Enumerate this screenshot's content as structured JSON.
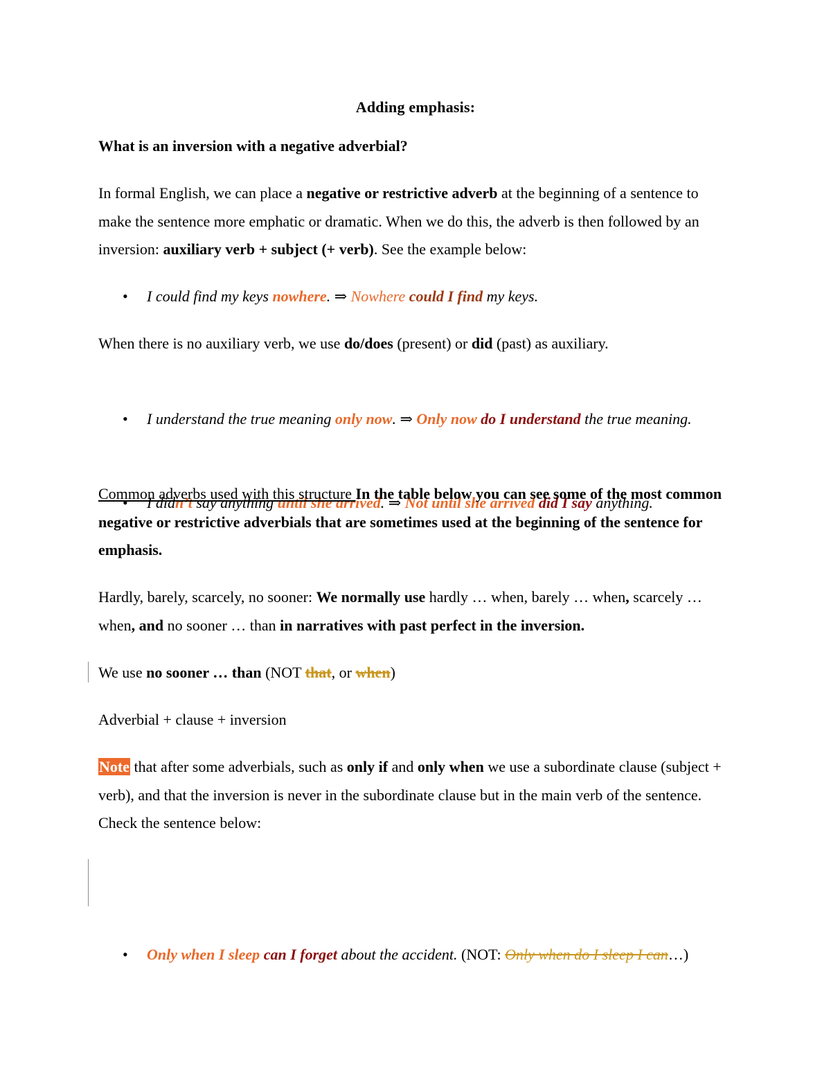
{
  "document": {
    "title": "Adding emphasis:",
    "heading": "What is an inversion with a negative adverbial?",
    "intro": {
      "runs": [
        "In formal English, we can place a ",
        "negative or restrictive adverb",
        " at the beginning of a sentence to make the sentence more emphatic or dramatic. When we do this, the adverb is then followed by an inversion: ",
        "auxiliary verb + subject (+ verb)",
        ". See the example below:"
      ]
    },
    "example1": {
      "bullet": "•",
      "runs": [
        "I could find my keys ",
        "nowhere",
        ". ",
        "⇒ ",
        "Nowhere",
        " ",
        "could I find",
        " my keys."
      ]
    },
    "auxiliary": {
      "runs": [
        "When there is no auxiliary verb, we use ",
        "do/does",
        " (present) or ",
        "did",
        " (past) as auxiliary."
      ]
    },
    "example2": {
      "bullet": "•",
      "runs": [
        "I understand the true meaning ",
        "only now",
        ". ⇒ ",
        "Only now",
        " ",
        "do I understand",
        " the true meaning."
      ]
    },
    "example3": {
      "bullet": "•",
      "runs": [
        "I did",
        "n’t",
        " say anything ",
        "until she arrived",
        ". ⇒ ",
        "Not until she arrived",
        " ",
        "did I say",
        " anything."
      ]
    },
    "common": {
      "runs": [
        "Common adverbs used with this structure ",
        "In the table below you can see some of the most common negative or restrictive adverbials that are sometimes used at the beginning of the sentence for emphasis."
      ]
    },
    "hardly": {
      "runs": [
        "Hardly, barely, scarcely, no sooner: ",
        "We normally use",
        " hardly … when, barely … when",
        ",",
        " scarcely … when",
        ", and",
        " no sooner … than ",
        "in narratives with past perfect in the inversion."
      ]
    },
    "no_sooner": {
      "runs": [
        "We use ",
        "no sooner … than",
        " (NOT ",
        "that",
        ", or ",
        "when",
        ")"
      ]
    },
    "structure": "Adverbial + clause + inversion",
    "note": {
      "runs": [
        "Note",
        " that after some adverbials, such as ",
        "only if",
        " and ",
        "only when",
        " we use a subordinate clause (subject + verb), and that the inversion is never in the subordinate clause but in the main verb of the sentence. Check the sentence below:"
      ]
    },
    "example4": {
      "bullet": "•",
      "runs": [
        "Only when I sleep",
        " ",
        "can I forget",
        " about the accident.",
        " (NOT: ",
        "Only when do I sleep I can",
        "…)"
      ]
    }
  },
  "colors": {
    "emphasis_orange": "#E8692A",
    "inversion_brown": "#9B3A14",
    "inversion_dark_red": "#8B1010",
    "deleted_text_gold": "#C9961F",
    "note_highlight": "#ED6A2C"
  }
}
